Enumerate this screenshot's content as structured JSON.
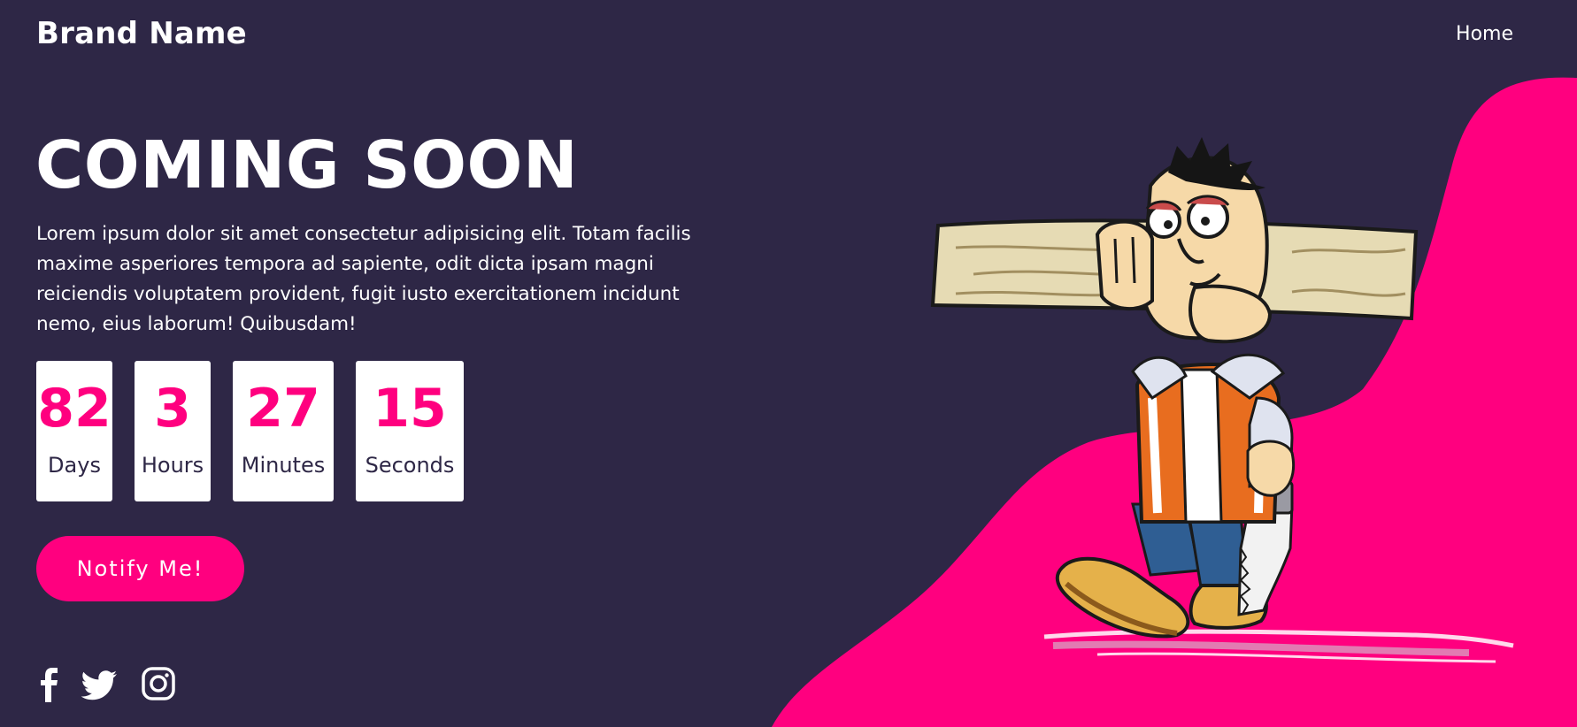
{
  "nav": {
    "brand": "Brand Name",
    "links": [
      {
        "label": "Home"
      }
    ]
  },
  "hero": {
    "title": "COMING SOON",
    "description": "Lorem ipsum dolor sit amet consectetur adipisicing elit. Totam facilis maxime asperiores tempora ad sapiente, odit dicta ipsam magni reiciendis voluptatem provident, fugit iusto exercitationem incidunt nemo, eius laborum! Quibusdam!"
  },
  "countdown": [
    {
      "value": "82",
      "label": "Days"
    },
    {
      "value": "3",
      "label": "Hours"
    },
    {
      "value": "27",
      "label": "Minutes"
    },
    {
      "value": "15",
      "label": "Seconds"
    }
  ],
  "cta": {
    "label": "Notify Me!"
  },
  "social": [
    {
      "icon": "facebook-icon"
    },
    {
      "icon": "twitter-icon"
    },
    {
      "icon": "instagram-icon"
    }
  ],
  "illustration": {
    "subject": "carpenter-carrying-plank-icon"
  },
  "colors": {
    "background": "#2e2746",
    "accent": "#ff007f",
    "text": "#ffffff",
    "box": "#ffffff"
  }
}
